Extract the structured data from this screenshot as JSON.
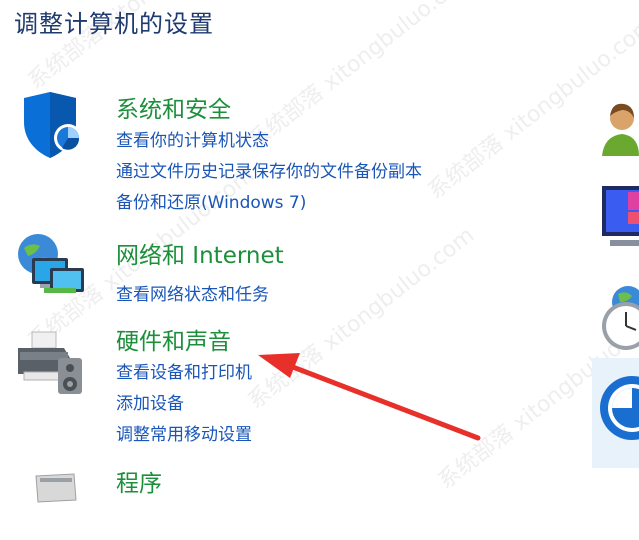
{
  "page": {
    "title": "调整计算机的设置"
  },
  "categories": [
    {
      "title": "系统和安全",
      "links": [
        "查看你的计算机状态",
        "通过文件历史记录保存你的文件备份副本",
        "备份和还原(Windows 7)"
      ]
    },
    {
      "title": "网络和 Internet",
      "links": [
        "查看网络状态和任务"
      ]
    },
    {
      "title": "硬件和声音",
      "links": [
        "查看设备和打印机",
        "添加设备",
        "调整常用移动设置"
      ]
    },
    {
      "title": "程序",
      "links": []
    }
  ],
  "watermark": {
    "text": "系统部落 xitongbuluo.com"
  },
  "colors": {
    "title": "#1e3a6e",
    "category": "#1c8f3b",
    "link": "#1a56b8",
    "arrow": "#e8302b"
  }
}
